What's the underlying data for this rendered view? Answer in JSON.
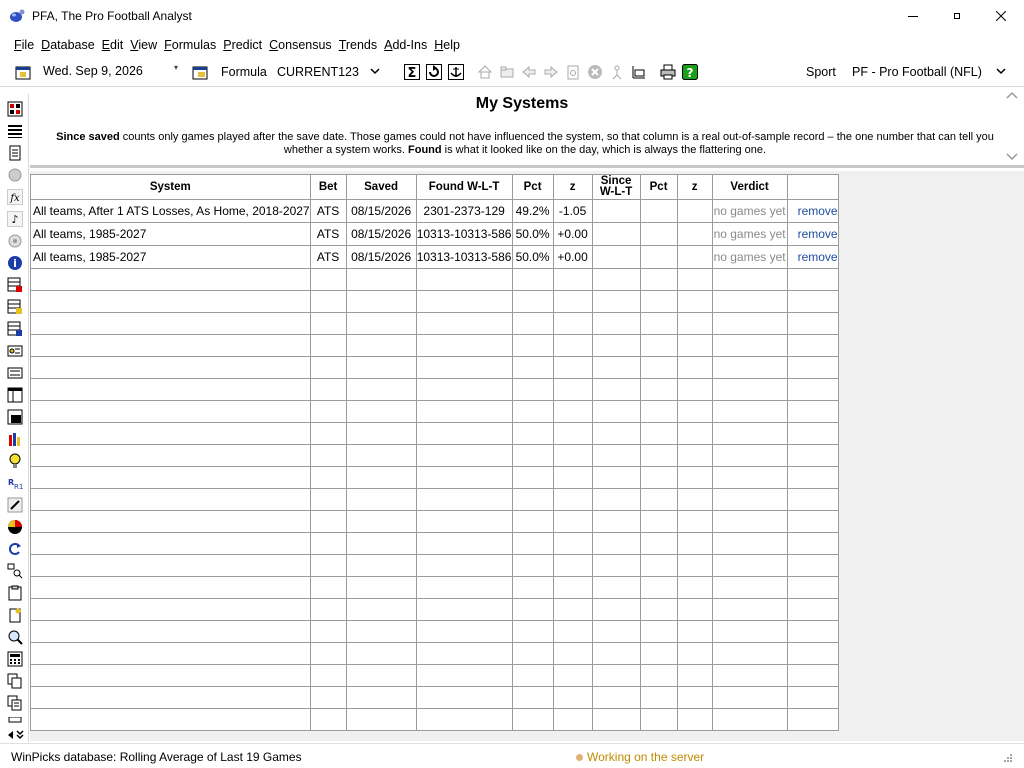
{
  "window": {
    "title": "PFA, The Pro Football Analyst"
  },
  "menu": {
    "items": [
      "File",
      "Database",
      "Edit",
      "View",
      "Formulas",
      "Predict",
      "Consensus",
      "Trends",
      "Add-Ins",
      "Help"
    ]
  },
  "toolbar": {
    "date": "Wed. Sep  9, 2026",
    "formula_label": "Formula",
    "formula_value": "CURRENT123",
    "sport_label": "Sport",
    "sport_value": "PF - Pro Football (NFL)"
  },
  "header": {
    "title": "My Systems",
    "desc_bold1": "Since saved",
    "desc_text1": " counts only games played after the save date. Those games could not have influenced the system, so that column is a real out-of-sample record – the one number that can tell you whether a system works. ",
    "desc_bold2": "Found",
    "desc_text2": " is what it looked like on the day, which is always the flattering one."
  },
  "table": {
    "columns": [
      "System",
      "Bet",
      "Saved",
      "Found W-L-T",
      "Pct",
      "z",
      "Since W-L-T",
      "Pct",
      "z",
      "Verdict",
      ""
    ],
    "rows": [
      {
        "system": "All teams, After 1 ATS Losses, As Home, 2018-2027",
        "bet": "ATS",
        "saved": "08/15/2026",
        "found": "2301-2373-129",
        "pct": "49.2%",
        "z": "-1.05",
        "since": "",
        "since_pct": "",
        "since_z": "",
        "verdict": "no games yet",
        "action": "remove"
      },
      {
        "system": "All teams, 1985-2027",
        "bet": "ATS",
        "saved": "08/15/2026",
        "found": "10313-10313-586",
        "pct": "50.0%",
        "z": "+0.00",
        "since": "",
        "since_pct": "",
        "since_z": "",
        "verdict": "no games yet",
        "action": "remove"
      },
      {
        "system": "All teams, 1985-2027",
        "bet": "ATS",
        "saved": "08/15/2026",
        "found": "10313-10313-586",
        "pct": "50.0%",
        "z": "+0.00",
        "since": "",
        "since_pct": "",
        "since_z": "",
        "verdict": "no games yet",
        "action": "remove"
      }
    ]
  },
  "status": {
    "left": "WinPicks database:  Rolling Average of Last 19 Games",
    "right": "Working on the server"
  },
  "icons": {
    "minimize": "minimize-icon",
    "maximize": "maximize-icon",
    "close": "close-icon"
  },
  "colors": {
    "link": "#1f4fa0",
    "status_working": "#c28a00",
    "muted": "#8a8a8a"
  }
}
